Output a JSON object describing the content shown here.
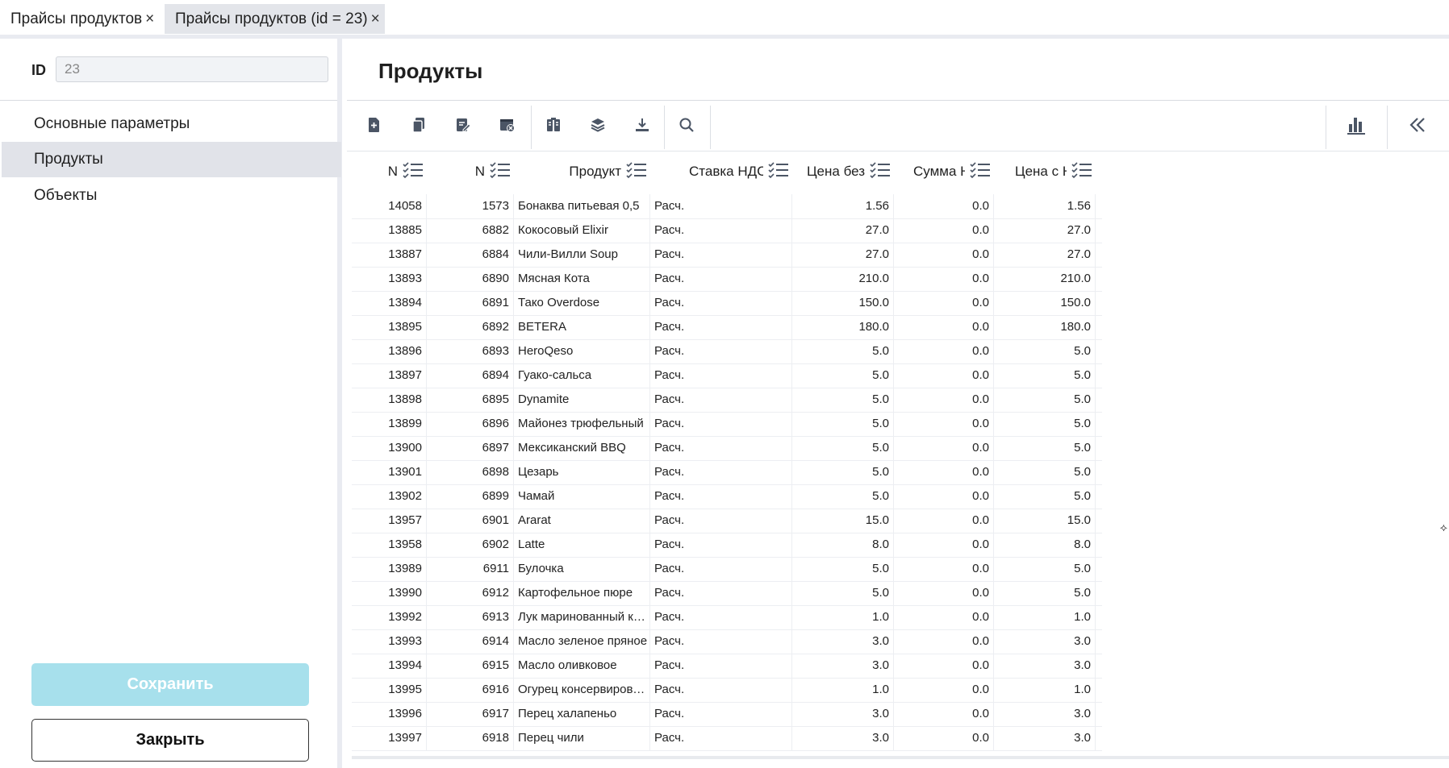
{
  "tabs": [
    {
      "label": "Прайсы продуктов",
      "close": "×"
    },
    {
      "label": "Прайсы продуктов (id = 23)",
      "close": "×"
    }
  ],
  "sidebar": {
    "id_label": "ID",
    "id_value": "23",
    "items": [
      {
        "label": "Основные параметры"
      },
      {
        "label": "Продукты"
      },
      {
        "label": "Объекты"
      }
    ],
    "save_label": "Сохранить",
    "close_label": "Закрыть"
  },
  "main": {
    "title": "Продукты",
    "toolbar": [
      "add-icon",
      "copy-icon",
      "edit-icon",
      "delete-icon",
      "columns-icon",
      "layers-icon",
      "download-icon",
      "search-icon",
      "chart-icon",
      "collapse-icon"
    ],
    "columns": [
      "N",
      "N",
      "Продукт",
      "Ставка НДС",
      "Цена без",
      "Сумма Н",
      "Цена с Н"
    ],
    "rows": [
      [
        "14058",
        "1573",
        "Бонаква питьевая 0,5",
        "Расч.",
        "1.56",
        "0.0",
        "1.56"
      ],
      [
        "13885",
        "6882",
        "Кокосовый Elixir",
        "Расч.",
        "27.0",
        "0.0",
        "27.0"
      ],
      [
        "13887",
        "6884",
        "Чили-Вилли Soup",
        "Расч.",
        "27.0",
        "0.0",
        "27.0"
      ],
      [
        "13893",
        "6890",
        "Мясная Кота",
        "Расч.",
        "210.0",
        "0.0",
        "210.0"
      ],
      [
        "13894",
        "6891",
        "Тако Overdose",
        "Расч.",
        "150.0",
        "0.0",
        "150.0"
      ],
      [
        "13895",
        "6892",
        "BETERA",
        "Расч.",
        "180.0",
        "0.0",
        "180.0"
      ],
      [
        "13896",
        "6893",
        "HeroQeso",
        "Расч.",
        "5.0",
        "0.0",
        "5.0"
      ],
      [
        "13897",
        "6894",
        "Гуако-сальса",
        "Расч.",
        "5.0",
        "0.0",
        "5.0"
      ],
      [
        "13898",
        "6895",
        "Dynamite",
        "Расч.",
        "5.0",
        "0.0",
        "5.0"
      ],
      [
        "13899",
        "6896",
        "Майонез трюфельный",
        "Расч.",
        "5.0",
        "0.0",
        "5.0"
      ],
      [
        "13900",
        "6897",
        "Мексиканский BBQ",
        "Расч.",
        "5.0",
        "0.0",
        "5.0"
      ],
      [
        "13901",
        "6898",
        "Цезарь",
        "Расч.",
        "5.0",
        "0.0",
        "5.0"
      ],
      [
        "13902",
        "6899",
        "Чамай",
        "Расч.",
        "5.0",
        "0.0",
        "5.0"
      ],
      [
        "13957",
        "6901",
        "Ararat",
        "Расч.",
        "15.0",
        "0.0",
        "15.0"
      ],
      [
        "13958",
        "6902",
        "Latte",
        "Расч.",
        "8.0",
        "0.0",
        "8.0"
      ],
      [
        "13989",
        "6911",
        "Булочка",
        "Расч.",
        "5.0",
        "0.0",
        "5.0"
      ],
      [
        "13990",
        "6912",
        "Картофельное пюре",
        "Расч.",
        "5.0",
        "0.0",
        "5.0"
      ],
      [
        "13992",
        "6913",
        "Лук маринованный кр...",
        "Расч.",
        "1.0",
        "0.0",
        "1.0"
      ],
      [
        "13993",
        "6914",
        "Масло зеленое пряное",
        "Расч.",
        "3.0",
        "0.0",
        "3.0"
      ],
      [
        "13994",
        "6915",
        "Масло оливковое",
        "Расч.",
        "3.0",
        "0.0",
        "3.0"
      ],
      [
        "13995",
        "6916",
        "Огурец консервирова...",
        "Расч.",
        "1.0",
        "0.0",
        "1.0"
      ],
      [
        "13996",
        "6917",
        "Перец халапеньо",
        "Расч.",
        "3.0",
        "0.0",
        "3.0"
      ],
      [
        "13997",
        "6918",
        "Перец чили",
        "Расч.",
        "3.0",
        "0.0",
        "3.0"
      ]
    ],
    "edge_glyph": "⟡"
  }
}
